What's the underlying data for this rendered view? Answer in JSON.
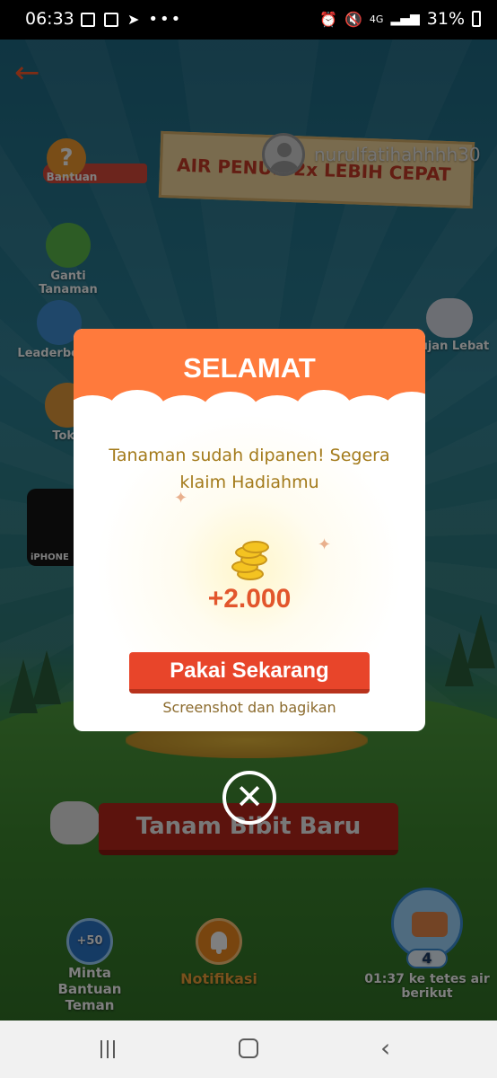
{
  "status_bar": {
    "time": "06:33",
    "battery": "31%",
    "network": "4G"
  },
  "game": {
    "banner_text": "AIR PENUH 2x LEBIH CEPAT",
    "username": "nurulfatihahhhh30",
    "help_label": "Bantuan",
    "side_left": [
      {
        "label": "Ganti Tanaman"
      },
      {
        "label": "Leaderboard"
      },
      {
        "label": "Toko"
      }
    ],
    "side_right_label": "Hujan Lebat",
    "phone_promo_label": "iPHONE",
    "plant_button": "Tanam Bibit Baru",
    "bottom": {
      "help_friend_circle": "+50",
      "help_friend_label": "Minta Bantuan Teman",
      "notification_label": "Notifikasi",
      "water_count": "4",
      "next_drop_text": "01:37 ke tetes air berikut"
    }
  },
  "modal": {
    "title": "SELAMAT",
    "message": "Tanaman sudah dipanen! Segera klaim Hadiahmu",
    "reward": "+2.000",
    "use_button": "Pakai Sekarang",
    "share_text": "Screenshot dan bagikan"
  },
  "colors": {
    "modal_header": "#ff7a3c",
    "use_button": "#e8452a",
    "reward_text": "#e2562c"
  }
}
